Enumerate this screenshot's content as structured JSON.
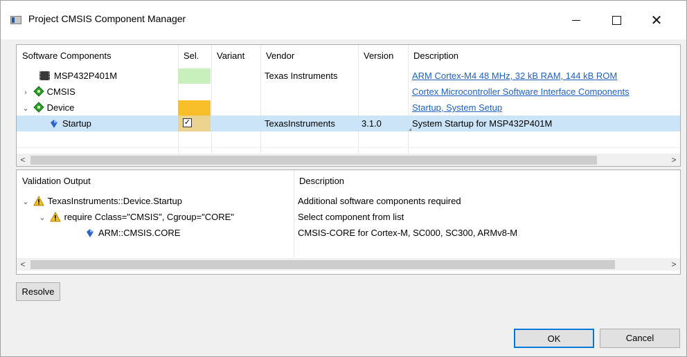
{
  "window": {
    "title": "Project CMSIS Component Manager",
    "controls": {
      "minimize": "minimize",
      "maximize": "maximize",
      "close": "✕"
    }
  },
  "components": {
    "headers": [
      "Software Components",
      "Sel.",
      "Variant",
      "Vendor",
      "Version",
      "Description"
    ],
    "rows": [
      {
        "name": "MSP432P401M",
        "icon": "chip-icon",
        "sel_color": "#c8f0bd",
        "variant": "",
        "vendor": "Texas Instruments",
        "version": "",
        "description": "ARM Cortex-M4 48 MHz, 32 kB RAM, 144 kB ROM",
        "desc_link": true
      },
      {
        "name": "CMSIS",
        "icon": "component-icon",
        "expand": "collapsed",
        "variant": "",
        "vendor": "",
        "version": "",
        "description": "Cortex Microcontroller Software Interface Components",
        "desc_link": true
      },
      {
        "name": "Device",
        "icon": "component-icon",
        "expand": "expanded",
        "sel_color": "#f8bf2a",
        "variant": "",
        "vendor": "",
        "version": "",
        "description": "Startup, System Setup",
        "desc_link": true
      },
      {
        "name": "Startup",
        "icon": "gem-icon",
        "selected": true,
        "checked": true,
        "checkmark": "✓",
        "variant": "",
        "vendor": "TexasInstruments",
        "version": "3.1.0",
        "description": "System Startup for MSP432P401M",
        "desc_link": false
      }
    ],
    "scroll": {
      "left": "<",
      "right": ">"
    }
  },
  "validation": {
    "headers": [
      "Validation Output",
      "Description"
    ],
    "rows": [
      {
        "text": "TexasInstruments::Device.Startup",
        "icon": "warning-icon",
        "expand": "expanded",
        "description": "Additional software components required"
      },
      {
        "text": "require Cclass=\"CMSIS\", Cgroup=\"CORE\"",
        "icon": "warning-icon",
        "expand": "expanded",
        "description": "Select component from list"
      },
      {
        "text": "ARM::CMSIS.CORE",
        "icon": "gem-icon",
        "description": "CMSIS-CORE for Cortex-M, SC000, SC300, ARMv8-M"
      }
    ],
    "scroll": {
      "left": "<",
      "right": ">"
    }
  },
  "buttons": {
    "resolve": "Resolve",
    "ok": "OK",
    "cancel": "Cancel"
  },
  "colors": {
    "selection": "#cce4f7",
    "link": "#1f5fbf",
    "focus": "#0078d7"
  },
  "tree_glyphs": {
    "collapsed": "›",
    "expanded": "⌄"
  }
}
